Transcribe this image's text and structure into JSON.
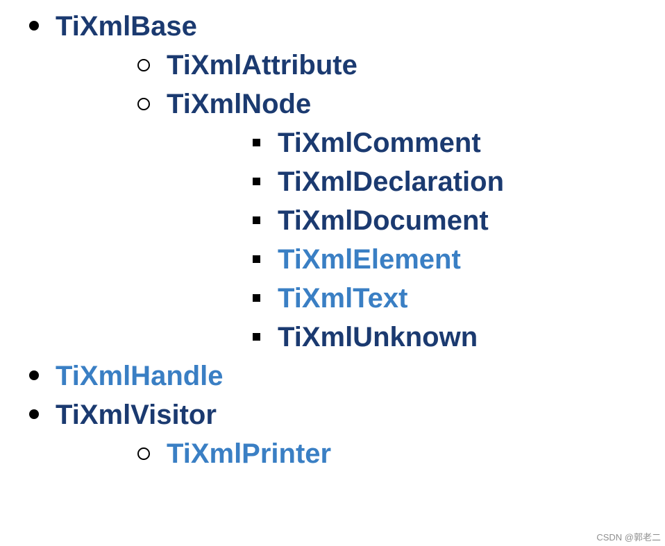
{
  "hierarchy": {
    "items": [
      {
        "label": "TiXmlBase",
        "style": "dark",
        "children": [
          {
            "label": "TiXmlAttribute",
            "style": "dark"
          },
          {
            "label": "TiXmlNode",
            "style": "dark",
            "children": [
              {
                "label": "TiXmlComment",
                "style": "dark"
              },
              {
                "label": "TiXmlDeclaration",
                "style": "dark"
              },
              {
                "label": "TiXmlDocument",
                "style": "dark"
              },
              {
                "label": "TiXmlElement",
                "style": "light"
              },
              {
                "label": "TiXmlText",
                "style": "light"
              },
              {
                "label": "TiXmlUnknown",
                "style": "dark"
              }
            ]
          }
        ]
      },
      {
        "label": "TiXmlHandle",
        "style": "light"
      },
      {
        "label": "TiXmlVisitor",
        "style": "dark",
        "children": [
          {
            "label": "TiXmlPrinter",
            "style": "light"
          }
        ]
      }
    ]
  },
  "colors": {
    "dark": "#1b3a70",
    "light": "#3a7fc4"
  },
  "watermark": "CSDN @郭老二"
}
